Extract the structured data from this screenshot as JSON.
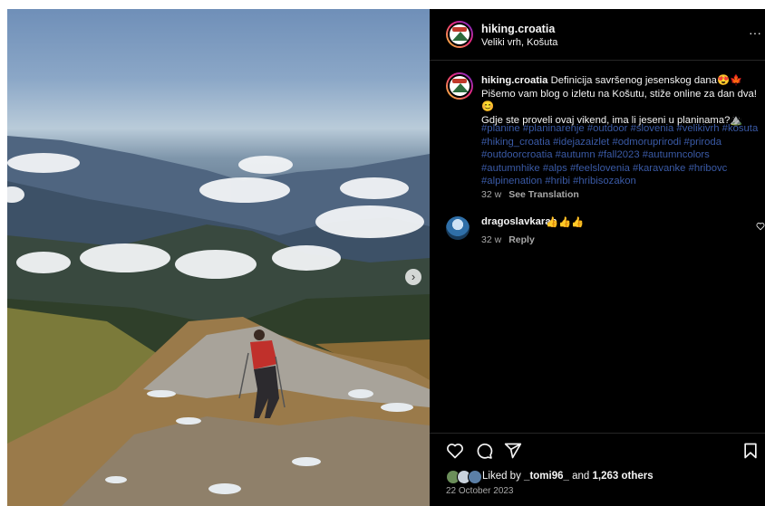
{
  "post": {
    "username": "hiking.croatia",
    "location": "Veliki vrh, Košuta",
    "more_label": "···"
  },
  "caption": {
    "username": "hiking.croatia",
    "text_line1": "Definicija savršenog jesenskog dana😍🍁",
    "text_line2": "Pišemo vam blog o izletu na Košutu, stiže online za dan dva!😊",
    "text_line3": "Gdje ste proveli ovaj vikend, ima li jeseni u planinama?⛰️",
    "hashtags": "#planine #planinarenje #outdoor #slovenia #velikivrh #kosuta #hiking_croatia #idejazaizlet #odmoruprirodi #priroda #outdoorcroatia #autumn #fall2023 #autumncolors #autumnhike #alps #feelslovenia #karavanke #hribovc #alpinenation #hribi #hribisozakon",
    "age": "32 w",
    "translate_label": "See Translation"
  },
  "comment": {
    "username": "dragoslavkaran",
    "text": "👍👍👍",
    "age": "32 w",
    "reply_label": "Reply"
  },
  "likes": {
    "prefix": "Liked by",
    "first_user": "_tomi96_",
    "middle": "and",
    "others": "1,263 others"
  },
  "date": "22 October 2023",
  "icons": {
    "like": "heart-icon",
    "comment": "comment-icon",
    "share": "share-icon",
    "save": "bookmark-icon",
    "next": "chevron-right-icon",
    "more": "more-icon"
  },
  "colors": {
    "background": "#000000",
    "hashtag": "#3a5aa6",
    "muted": "#a8a8a8",
    "text": "#f5f5f5"
  }
}
